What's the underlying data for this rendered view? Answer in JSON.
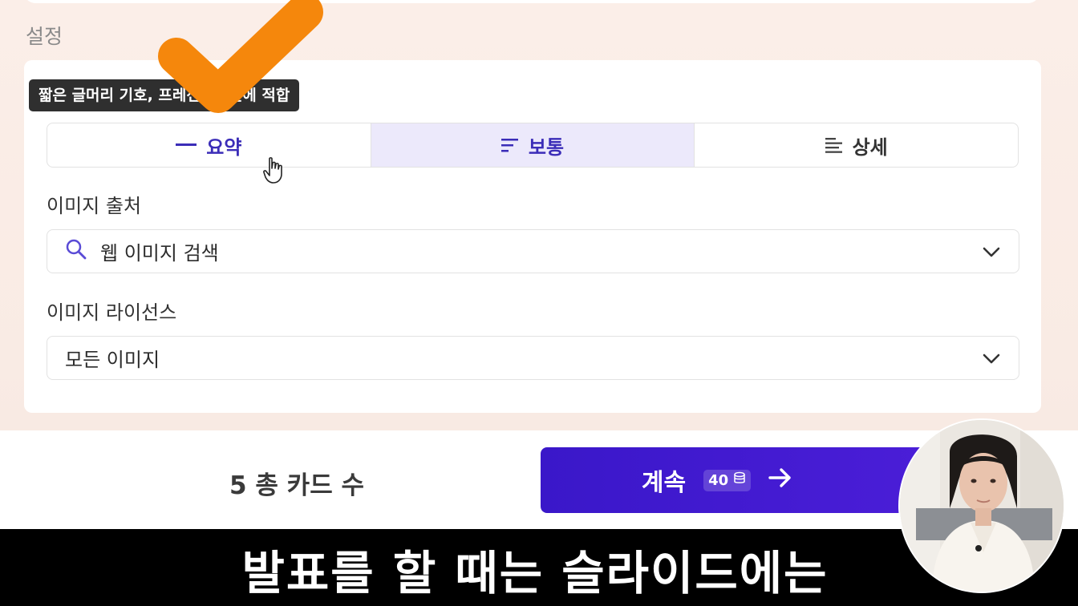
{
  "section": {
    "label": "설정"
  },
  "tooltip": {
    "text": "짧은 글머리 기호, 프레젠테이션에 적합"
  },
  "detail": {
    "options": [
      {
        "label": "요약",
        "icon": "dash-icon",
        "state": "hovered"
      },
      {
        "label": "보통",
        "icon": "lines-medium-icon",
        "state": "selected"
      },
      {
        "label": "상세",
        "icon": "lines-detailed-icon",
        "state": "default"
      }
    ]
  },
  "image_source": {
    "label": "이미지 출처",
    "value": "웹 이미지 검색",
    "icon": "search-icon"
  },
  "image_license": {
    "label": "이미지 라이선스",
    "value": "모든 이미지"
  },
  "footer": {
    "card_count_label": "5 총 카드 수",
    "continue_label": "계속",
    "credits": "40",
    "credit_icon": "coins-icon",
    "arrow_icon": "arrow-right-icon"
  },
  "subtitle": {
    "text": "발표를 할 때는 슬라이드에는"
  },
  "colors": {
    "accent": "#3b2db8",
    "button": "#3a17c9",
    "selected_bg": "#ece9fb",
    "checkmark": "#f5870c"
  }
}
